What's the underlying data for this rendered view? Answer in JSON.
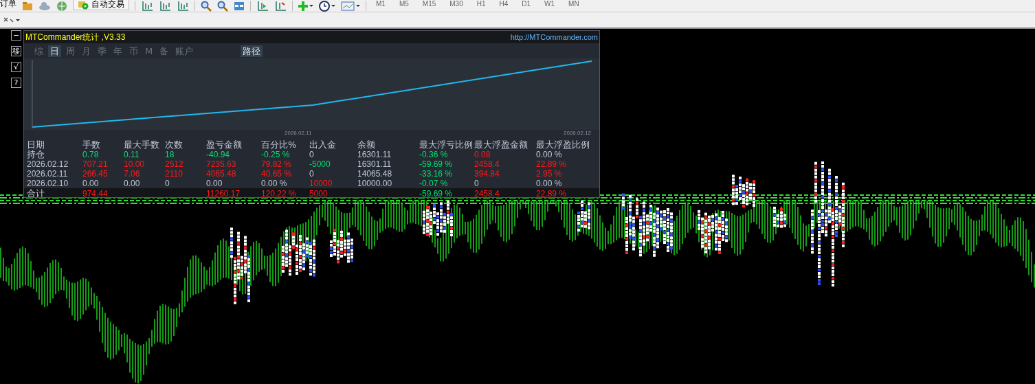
{
  "toolbar": {
    "order_label": "订单",
    "autotrade_label": "自动交易",
    "timeframes": [
      "M1",
      "M5",
      "M15",
      "M30",
      "H1",
      "H4",
      "D1",
      "W1",
      "MN"
    ]
  },
  "side_buttons": [
    "−",
    "移",
    "√",
    "?"
  ],
  "panel": {
    "title": "MTCommander统计 ,V3.33",
    "url": "http://MTCommander.com",
    "tabs": [
      {
        "label": "综",
        "selected": false
      },
      {
        "label": "日",
        "selected": true
      },
      {
        "label": "周",
        "selected": false
      },
      {
        "label": "月",
        "selected": false
      },
      {
        "label": "季",
        "selected": false
      },
      {
        "label": "年",
        "selected": false
      },
      {
        "label": "币",
        "selected": false
      },
      {
        "label": "M",
        "selected": false
      },
      {
        "label": "备",
        "selected": false
      },
      {
        "label": "账户",
        "selected": false
      }
    ],
    "path_tab": {
      "label": "路径",
      "selected": true
    },
    "chart_dates": [
      "2026.02.11",
      "2026.02.12"
    ],
    "columns": [
      "日期",
      "手数",
      "最大手数",
      "次数",
      "盈亏金额",
      "百分比%",
      "出入金",
      "余额",
      "最大浮亏比例",
      "最大浮盈金额",
      "最大浮盈比例"
    ],
    "rows": [
      {
        "cells": [
          {
            "text": "持仓",
            "color": "#c0c8d8"
          },
          {
            "text": "0.78",
            "color": "#00e070"
          },
          {
            "text": "0.11",
            "color": "#00e070"
          },
          {
            "text": "18",
            "color": "#00e070"
          },
          {
            "text": "-40.94",
            "color": "#00e070"
          },
          {
            "text": "-0.25 %",
            "color": "#00e070"
          },
          {
            "text": "0",
            "color": "#c0c8d8"
          },
          {
            "text": "16301.11",
            "color": "#c0c8d8"
          },
          {
            "text": "-0.36 %",
            "color": "#00e070"
          },
          {
            "text": "0.08",
            "color": "#ff1a1a"
          },
          {
            "text": "0.00 %",
            "color": "#c0c8d8"
          }
        ]
      },
      {
        "cells": [
          {
            "text": "2026.02.12",
            "color": "#c0c8d8"
          },
          {
            "text": "707.21",
            "color": "#ff1a1a"
          },
          {
            "text": "10.00",
            "color": "#ff1a1a"
          },
          {
            "text": "2512",
            "color": "#ff1a1a"
          },
          {
            "text": "7235.63",
            "color": "#ff1a1a"
          },
          {
            "text": "79.82 %",
            "color": "#ff1a1a"
          },
          {
            "text": "-5000",
            "color": "#00e070"
          },
          {
            "text": "16301.11",
            "color": "#c0c8d8"
          },
          {
            "text": "-59.69 %",
            "color": "#00e070"
          },
          {
            "text": "2458.4",
            "color": "#ff1a1a"
          },
          {
            "text": "22.89 %",
            "color": "#ff1a1a"
          }
        ]
      },
      {
        "cells": [
          {
            "text": "2026.02.11",
            "color": "#c0c8d8"
          },
          {
            "text": "266.45",
            "color": "#ff1a1a"
          },
          {
            "text": "7.06",
            "color": "#ff1a1a"
          },
          {
            "text": "2110",
            "color": "#ff1a1a"
          },
          {
            "text": "4065.48",
            "color": "#ff1a1a"
          },
          {
            "text": "40.65 %",
            "color": "#ff1a1a"
          },
          {
            "text": "0",
            "color": "#c0c8d8"
          },
          {
            "text": "14065.48",
            "color": "#c0c8d8"
          },
          {
            "text": "-33.16 %",
            "color": "#00e070"
          },
          {
            "text": "394.84",
            "color": "#ff1a1a"
          },
          {
            "text": "2.95 %",
            "color": "#ff1a1a"
          }
        ]
      },
      {
        "cells": [
          {
            "text": "2026.02.10",
            "color": "#c0c8d8"
          },
          {
            "text": "0.00",
            "color": "#c0c8d8"
          },
          {
            "text": "0.00",
            "color": "#c0c8d8"
          },
          {
            "text": "0",
            "color": "#c0c8d8"
          },
          {
            "text": "0.00",
            "color": "#c0c8d8"
          },
          {
            "text": "0.00 %",
            "color": "#c0c8d8"
          },
          {
            "text": "10000",
            "color": "#ff1a1a"
          },
          {
            "text": "10000.00",
            "color": "#c0c8d8"
          },
          {
            "text": "-0.07 %",
            "color": "#00e070"
          },
          {
            "text": "0",
            "color": "#c0c8d8"
          },
          {
            "text": "0.00 %",
            "color": "#c0c8d8"
          }
        ]
      },
      {
        "total": true,
        "cells": [
          {
            "text": "合计",
            "color": "#c0c8d8"
          },
          {
            "text": "974.44",
            "color": "#ff1a1a"
          },
          null,
          null,
          {
            "text": "11260.17",
            "color": "#ff1a1a"
          },
          {
            "text": "120.22 %",
            "color": "#ff1a1a"
          },
          {
            "text": "5000",
            "color": "#ff1a1a"
          },
          null,
          {
            "text": "-59.69 %",
            "color": "#00e070"
          },
          {
            "text": "2458.4",
            "color": "#ff1a1a"
          },
          {
            "text": "22.89 %",
            "color": "#ff1a1a"
          }
        ]
      }
    ]
  }
}
